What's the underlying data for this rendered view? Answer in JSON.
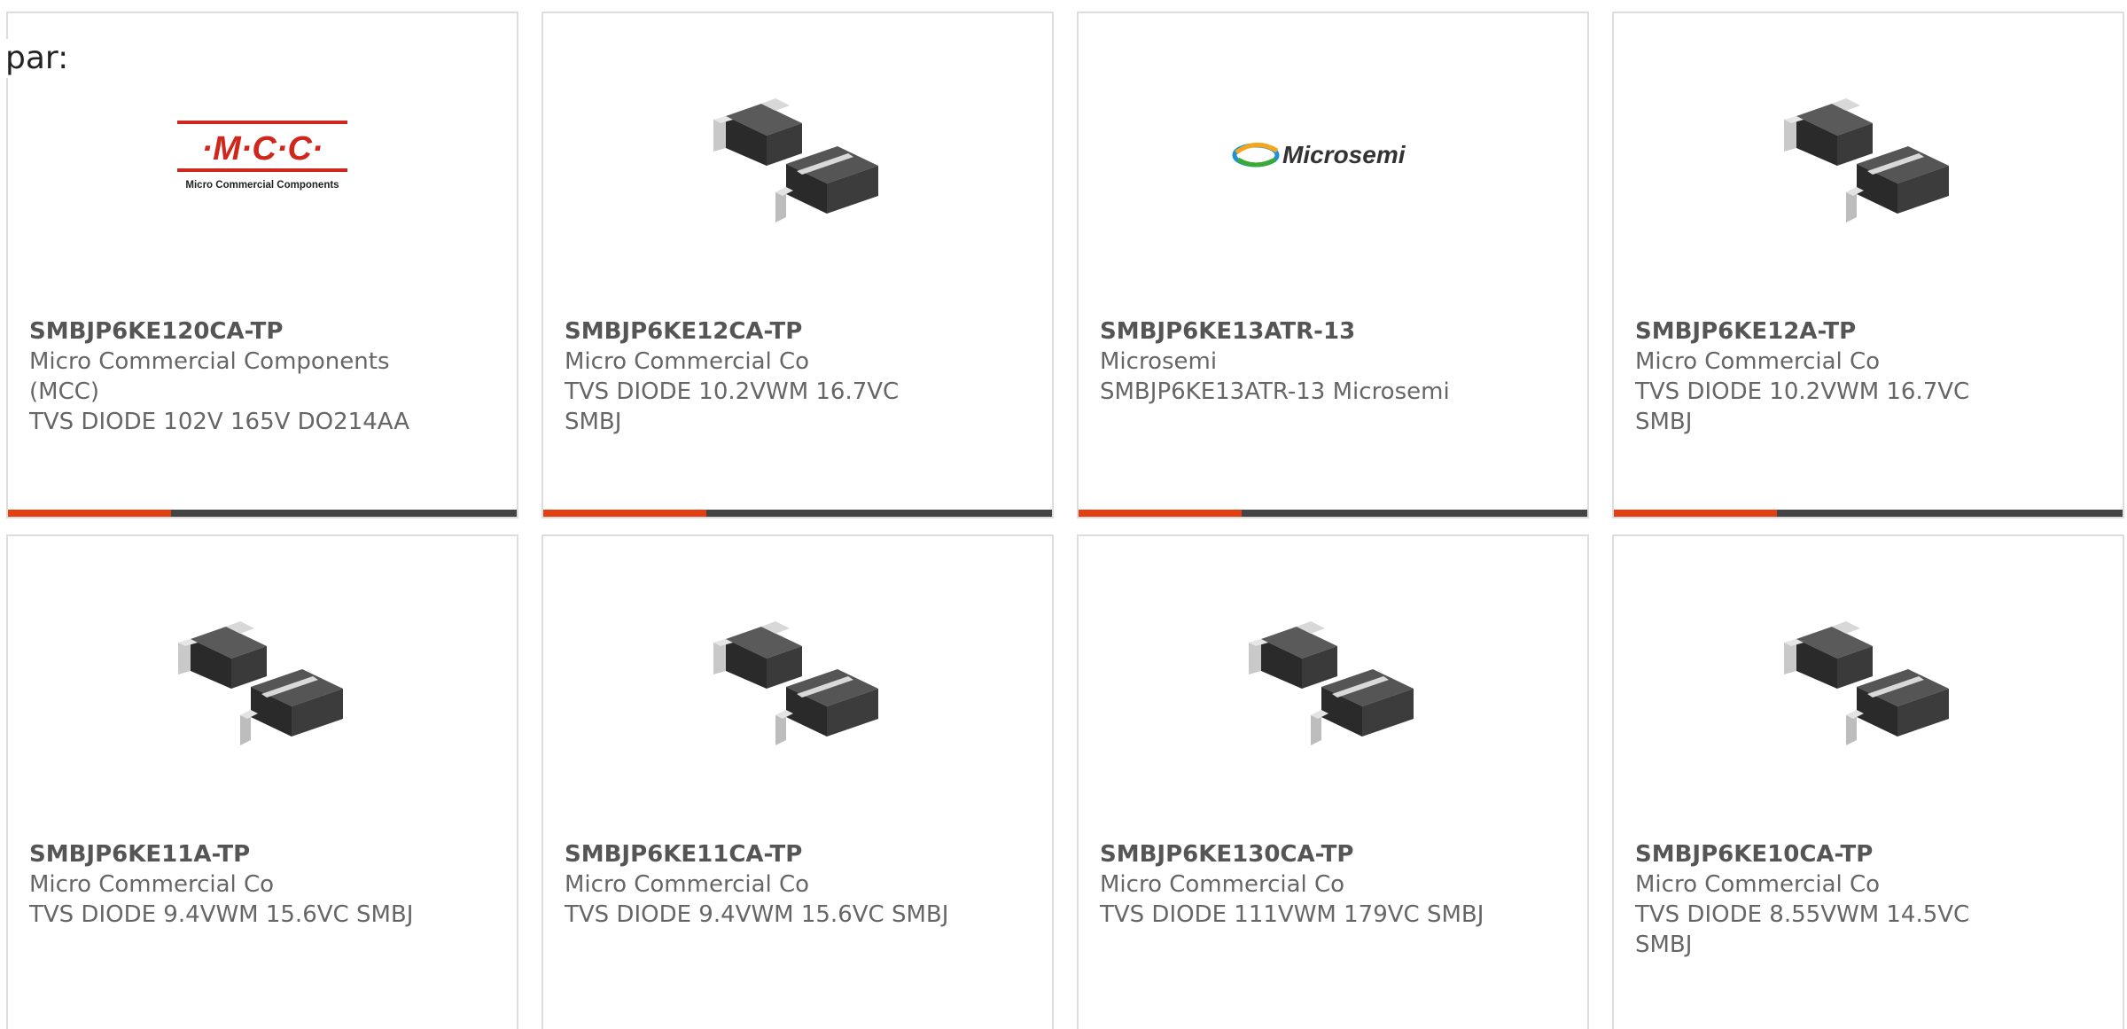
{
  "prefix_label": "par:",
  "colors": {
    "accent_orange": "#e43e13",
    "accent_dark": "#444444",
    "mcc_red": "#d0271d"
  },
  "logos": {
    "mcc_mark": "·M·C·C·",
    "mcc_tagline": "Micro Commercial Components",
    "microsemi": "Microsemi"
  },
  "products": [
    {
      "part_number": "SMBJP6KE120CA-TP",
      "manufacturer": "Micro Commercial Components (MCC)",
      "description": "TVS DIODE 102V 165V DO214AA",
      "image": "mcc-logo"
    },
    {
      "part_number": "SMBJP6KE12CA-TP",
      "manufacturer": "Micro Commercial Co",
      "description": "TVS DIODE 10.2VWM 16.7VC SMBJ",
      "image": "diode-package-icon"
    },
    {
      "part_number": "SMBJP6KE13ATR-13",
      "manufacturer": "Microsemi",
      "description": "SMBJP6KE13ATR-13 Microsemi",
      "image": "microsemi-logo"
    },
    {
      "part_number": "SMBJP6KE12A-TP",
      "manufacturer": "Micro Commercial Co",
      "description": "TVS DIODE 10.2VWM 16.7VC SMBJ",
      "image": "diode-package-icon"
    },
    {
      "part_number": "SMBJP6KE11A-TP",
      "manufacturer": "Micro Commercial Co",
      "description": "TVS DIODE 9.4VWM 15.6VC SMBJ",
      "image": "diode-package-icon"
    },
    {
      "part_number": "SMBJP6KE11CA-TP",
      "manufacturer": "Micro Commercial Co",
      "description": "TVS DIODE 9.4VWM 15.6VC SMBJ",
      "image": "diode-package-icon"
    },
    {
      "part_number": "SMBJP6KE130CA-TP",
      "manufacturer": "Micro Commercial Co",
      "description": "TVS DIODE 111VWM 179VC SMBJ",
      "image": "diode-package-icon"
    },
    {
      "part_number": "SMBJP6KE10CA-TP",
      "manufacturer": "Micro Commercial Co",
      "description": "TVS DIODE 8.55VWM 14.5VC SMBJ",
      "image": "diode-package-icon"
    }
  ]
}
